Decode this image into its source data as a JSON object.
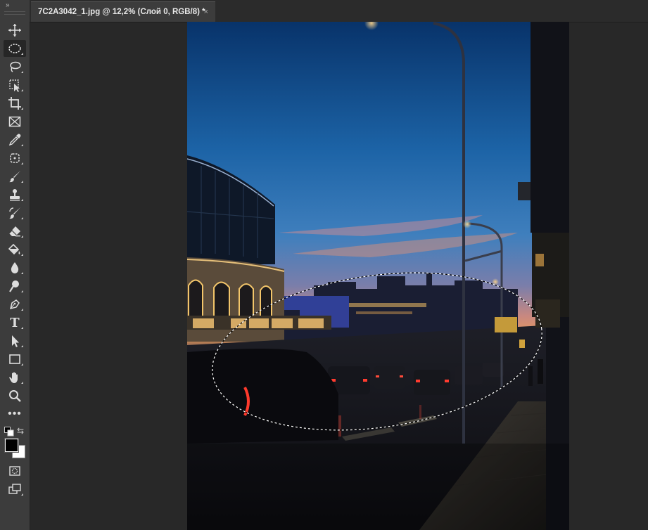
{
  "document": {
    "tab_title": "7C2A3042_1.jpg @ 12,2% (Слой 0, RGB/8) *",
    "close_glyph": "×"
  },
  "toolbar": {
    "collapse_glyph": "»",
    "type_tool_glyph": "T",
    "more_tools_glyph": "•••",
    "tools": [
      {
        "name": "move-tool-icon"
      },
      {
        "name": "elliptical-marquee-tool-icon",
        "active": true
      },
      {
        "name": "lasso-tool-icon"
      },
      {
        "name": "object-selection-tool-icon"
      },
      {
        "name": "crop-tool-icon"
      },
      {
        "name": "frame-tool-icon"
      },
      {
        "name": "eyedropper-tool-icon"
      },
      {
        "name": "healing-brush-tool-icon"
      },
      {
        "name": "brush-tool-icon"
      },
      {
        "name": "clone-stamp-tool-icon"
      },
      {
        "name": "history-brush-tool-icon"
      },
      {
        "name": "eraser-tool-icon"
      },
      {
        "name": "paint-bucket-tool-icon"
      },
      {
        "name": "blur-tool-icon"
      },
      {
        "name": "dodge-tool-icon"
      },
      {
        "name": "pen-tool-icon"
      },
      {
        "name": "type-tool-icon"
      },
      {
        "name": "path-selection-tool-icon"
      },
      {
        "name": "rectangle-tool-icon"
      },
      {
        "name": "hand-tool-icon"
      },
      {
        "name": "zoom-tool-icon"
      },
      {
        "name": "edit-toolbar-icon"
      }
    ],
    "foreground_color": "#000000",
    "background_color": "#ffffff"
  },
  "colors": {
    "ui_dark": "#282828",
    "toolbar_bg": "#3c3c3c",
    "selection_marquee": "#ffffff"
  }
}
